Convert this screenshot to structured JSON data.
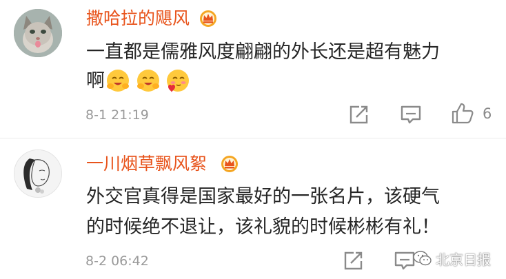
{
  "comments": [
    {
      "username": "撒哈拉的飓风",
      "text_line1": "一直都是儒雅风度翩翩的外长还是超有魅力",
      "text_line2": "啊",
      "emojis": [
        "hug-emoji",
        "hug-emoji",
        "heart-blush-emoji"
      ],
      "time": "8-1 21:19",
      "like_count": "6"
    },
    {
      "username": "一川烟草飘风絮",
      "text_line1": "外交官真得是国家最好的一张名片，该硬气",
      "text_line2": "的时候绝不退让，该礼貌的时候彬彬有礼！",
      "time": "8-2 06:42"
    }
  ],
  "watermark": {
    "text": "北京日报"
  },
  "colors": {
    "username": "#e8541c",
    "text": "#262626",
    "meta": "#9a9a9a",
    "icon": "#8a8a8a"
  }
}
